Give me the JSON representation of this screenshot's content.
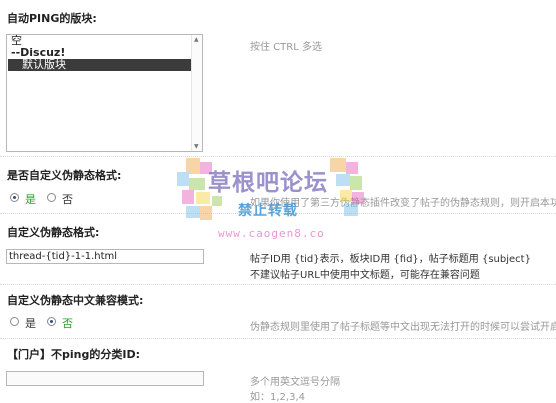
{
  "auto_ping": {
    "label": "自动PING的版块:",
    "hint": "按住 CTRL 多选",
    "options": [
      {
        "text": "空"
      },
      {
        "text": "--Discuz!"
      },
      {
        "text": "默认版块"
      }
    ]
  },
  "custom_static": {
    "label": "是否自定义伪静态格式:",
    "yes": "是",
    "no": "否",
    "selected": "yes",
    "hint": "如果你使用了第三方伪静态插件改变了帖子的伪静态规则，则开启本功能"
  },
  "static_format": {
    "label": "自定义伪静态格式:",
    "value": "thread-{tid}-1-1.html",
    "hint_line1": "帖子ID用 {tid}表示，板块ID用 {fid}，帖子标题用 {subject}",
    "hint_line2": "不建议帖子URL中使用中文标题，可能存在兼容问题"
  },
  "cn_compat": {
    "label": "自定义伪静态中文兼容模式:",
    "yes": "是",
    "no": "否",
    "selected": "no",
    "hint": "伪静态规则里使用了帖子标题等中文出现无法打开的时候可以尝试开启"
  },
  "portal_exclude": {
    "label": "【门户】不ping的分类ID:",
    "value": "",
    "hint_line1": "多个用英文逗号分隔",
    "hint_line2": "如：1,2,3,4"
  },
  "watermark": {
    "line1": "草根吧论坛",
    "line2": "禁止转载",
    "line3": "www.caogen8.co"
  }
}
